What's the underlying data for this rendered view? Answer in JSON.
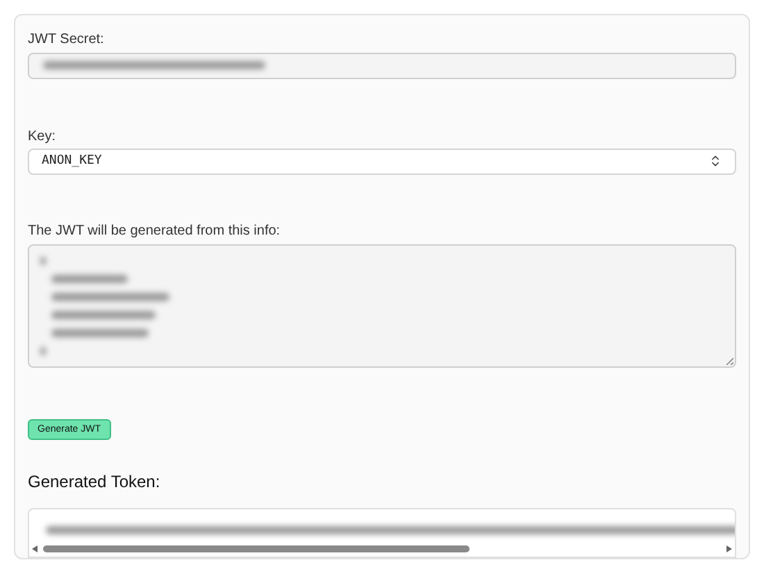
{
  "secret_field": {
    "label": "JWT Secret:"
  },
  "key_select": {
    "label": "Key:",
    "value": "ANON_KEY"
  },
  "info_field": {
    "label": "The JWT will be generated from this info:"
  },
  "generate_button": {
    "label": "Generate JWT"
  },
  "token_section": {
    "heading": "Generated Token:"
  }
}
